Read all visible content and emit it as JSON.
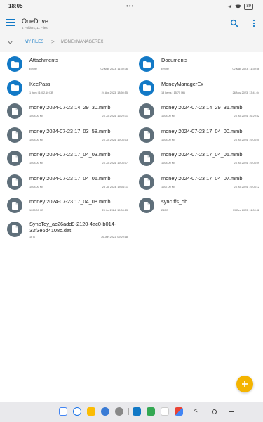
{
  "status_bar": {
    "time": "18:05",
    "dots": "•••",
    "battery": "89"
  },
  "app_bar": {
    "title": "OneDrive",
    "subtitle": "4 Folders, 11 Files"
  },
  "breadcrumb": {
    "root": "MY FILES",
    "separator": ">",
    "current": "MONEYMANAGEREX"
  },
  "files": [
    {
      "name": "Attachments",
      "type": "folder",
      "meta_left": "Empty",
      "meta_right": "02 May 2023, 11:39:36"
    },
    {
      "name": "Documents",
      "type": "folder",
      "meta_left": "Empty",
      "meta_right": "02 May 2023, 11:39:36"
    },
    {
      "name": "KeePass",
      "type": "folder",
      "meta_left": "1 Item | 1002.10 KB",
      "meta_right": "24 Apr 2023, 18:50:55"
    },
    {
      "name": "MoneyManagerEx",
      "type": "folder",
      "meta_left": "18 Items | 15.75 MB",
      "meta_right": "26 Nov 2023, 13:41:04"
    },
    {
      "name": "money 2024-07-23 14_29_30.mmb",
      "type": "doc",
      "meta_left": "1008.00 KB",
      "meta_right": "23 Jul 2024, 16:29:31"
    },
    {
      "name": "money 2024-07-23 14_29_31.mmb",
      "type": "doc",
      "meta_left": "1008.00 KB",
      "meta_right": "23 Jul 2024, 16:29:32"
    },
    {
      "name": "money 2024-07-23 17_03_58.mmb",
      "type": "doc",
      "meta_left": "1008.00 KB",
      "meta_right": "23 Jul 2024, 19:04:03"
    },
    {
      "name": "money 2024-07-23 17_04_00.mmb",
      "type": "doc",
      "meta_left": "1008.00 KB",
      "meta_right": "23 Jul 2024, 19:04:05"
    },
    {
      "name": "money 2024-07-23 17_04_03.mmb",
      "type": "doc",
      "meta_left": "1008.00 KB",
      "meta_right": "23 Jul 2024, 19:04:07"
    },
    {
      "name": "money 2024-07-23 17_04_05.mmb",
      "type": "doc",
      "meta_left": "1008.00 KB",
      "meta_right": "23 Jul 2024, 19:04:09"
    },
    {
      "name": "money 2024-07-23 17_04_06.mmb",
      "type": "doc",
      "meta_left": "1008.00 KB",
      "meta_right": "23 Jul 2024, 19:04:11"
    },
    {
      "name": "money 2024-07-23 17_04_07.mmb",
      "type": "doc",
      "meta_left": "1007.00 KB",
      "meta_right": "23 Jul 2024, 19:04:12"
    },
    {
      "name": "money 2024-07-23 17_04_08.mmb",
      "type": "doc",
      "meta_left": "1008.00 KB",
      "meta_right": "23 Jul 2024, 19:04:13"
    },
    {
      "name": "sync.ffs_db",
      "type": "doc",
      "meta_left": "240 B",
      "meta_right": "19 Dec 2023, 11:00:32"
    },
    {
      "name": "SyncToy_ac26add9-2120-4ac0-b014-33f3e6d4108c.dat",
      "type": "doc",
      "meta_left": "16 B",
      "meta_right": "26 Jun 2021, 09:29:18"
    }
  ],
  "colors": {
    "accent": "#1279c6",
    "doc_icon": "#5f6f7a",
    "fab": "#f4b400",
    "bar_bg": "#f4f4f4"
  },
  "icons": {
    "menu": "hamburger-icon",
    "search": "search-icon",
    "more": "more-vert-icon",
    "folder": "folder-icon",
    "file": "file-icon",
    "add": "plus-icon"
  }
}
